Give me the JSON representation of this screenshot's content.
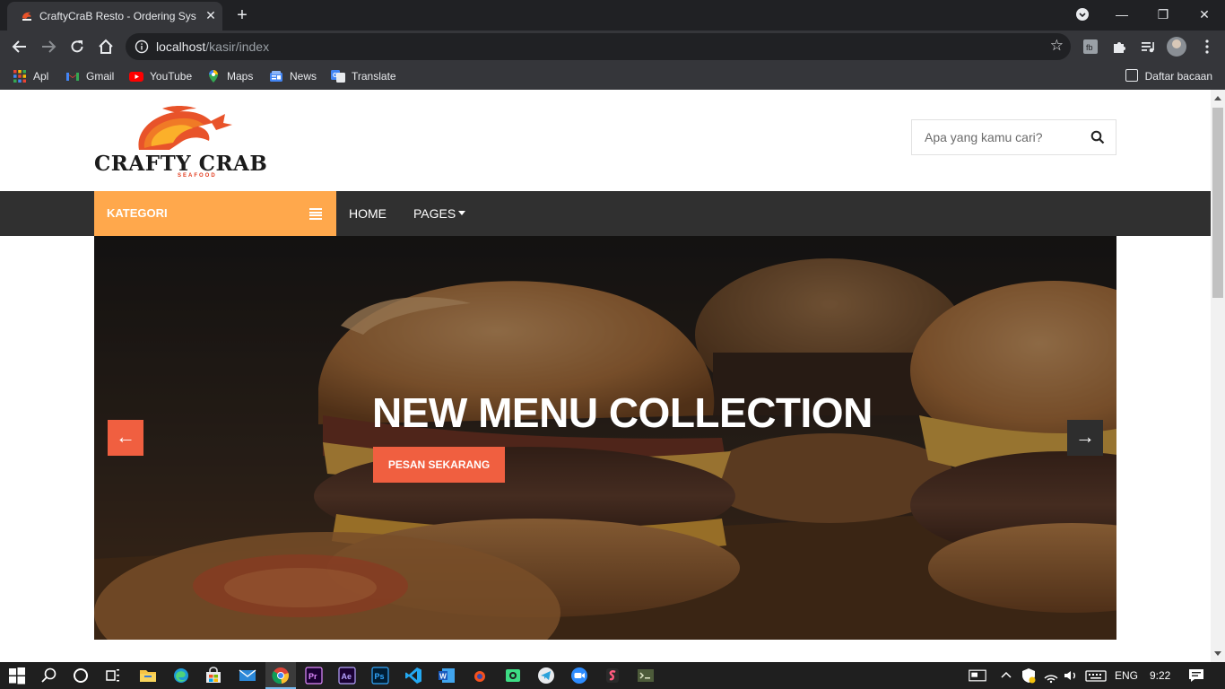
{
  "browser": {
    "tab_title": "CraftyCraB Resto - Ordering System",
    "tab_close": "✕",
    "new_tab": "+",
    "url_host": "localhost",
    "url_path": "/kasir/index",
    "star_glyph": "☆",
    "window_controls": {
      "minimize": "—",
      "maximize": "❐",
      "close": "✕"
    },
    "bookmarks": [
      {
        "label": "Apl",
        "icon": "apps-grid-icon"
      },
      {
        "label": "Gmail",
        "icon": "gmail-icon"
      },
      {
        "label": "YouTube",
        "icon": "youtube-icon"
      },
      {
        "label": "Maps",
        "icon": "maps-icon"
      },
      {
        "label": "News",
        "icon": "news-icon"
      },
      {
        "label": "Translate",
        "icon": "translate-icon"
      }
    ],
    "reading_list": "Daftar bacaan"
  },
  "site": {
    "logo_wordmark": "CRAFTY CRAB",
    "logo_tagline": "SEAFOOD",
    "search_placeholder": "Apa yang kamu cari?",
    "category_label": "KATEGORI",
    "nav": [
      {
        "label": "HOME"
      },
      {
        "label": "PAGES"
      }
    ],
    "hero": {
      "headline": "NEW MENU COLLECTION",
      "cta": "PESAN SEKARANG",
      "prev": "←",
      "next": "→"
    },
    "accent_color": "#ffa84c",
    "cta_color": "#f05f40"
  },
  "taskbar": {
    "language": "ENG",
    "time": "9:22"
  }
}
